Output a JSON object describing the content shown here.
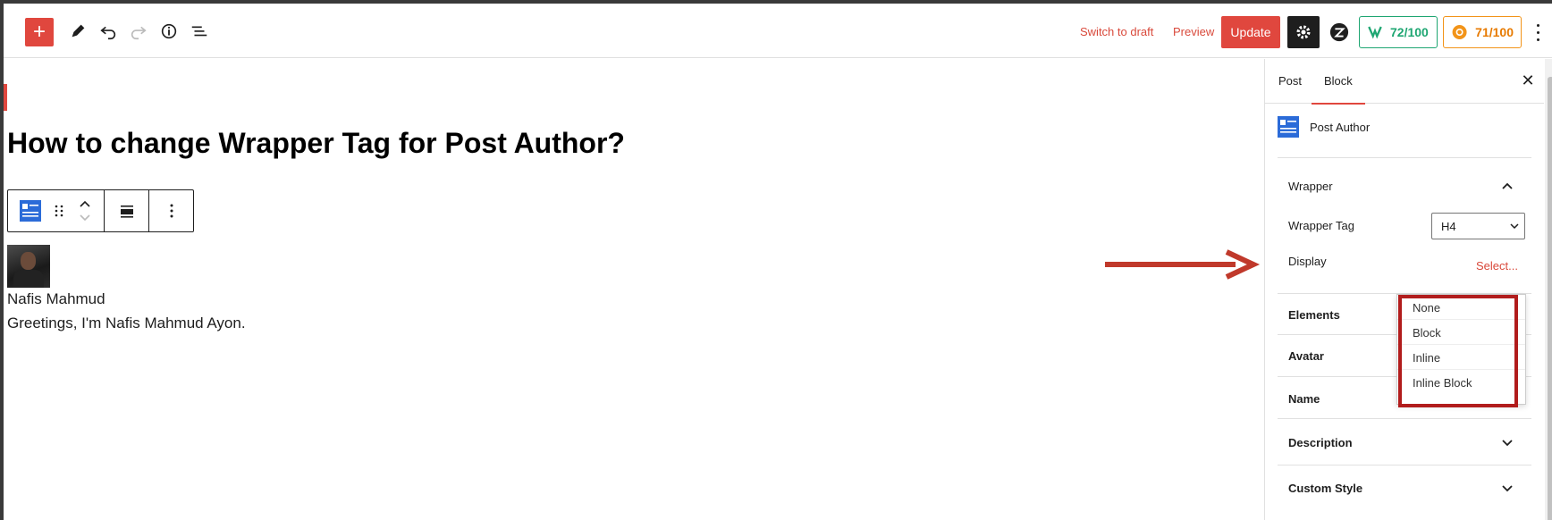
{
  "toolbar": {
    "add_icon": "plus-icon",
    "switch_to_draft": "Switch to draft",
    "preview": "Preview",
    "update": "Update",
    "score_seo": "72/100",
    "score_readability": "71/100"
  },
  "post": {
    "title": "How to change Wrapper Tag for Post Author?",
    "author_name": "Nafis Mahmud",
    "author_description": "Greetings, I'm Nafis Mahmud Ayon."
  },
  "sidebar": {
    "tabs": [
      {
        "label": "Post"
      },
      {
        "label": "Block"
      }
    ],
    "active_tab": "Block",
    "block_name": "Post Author",
    "wrapper": {
      "title": "Wrapper",
      "wrapper_tag_label": "Wrapper Tag",
      "wrapper_tag_value": "H4",
      "display_label": "Display",
      "display_value": "Select..."
    },
    "display_options": [
      "None",
      "Block",
      "Inline",
      "Inline Block"
    ],
    "sections": [
      "Elements",
      "Avatar",
      "Name",
      "Description",
      "Custom Style"
    ]
  },
  "colors": {
    "accent": "#e0473e",
    "annotation": "#c0392b",
    "score_green": "#1ea672",
    "score_orange": "#e77a00"
  }
}
